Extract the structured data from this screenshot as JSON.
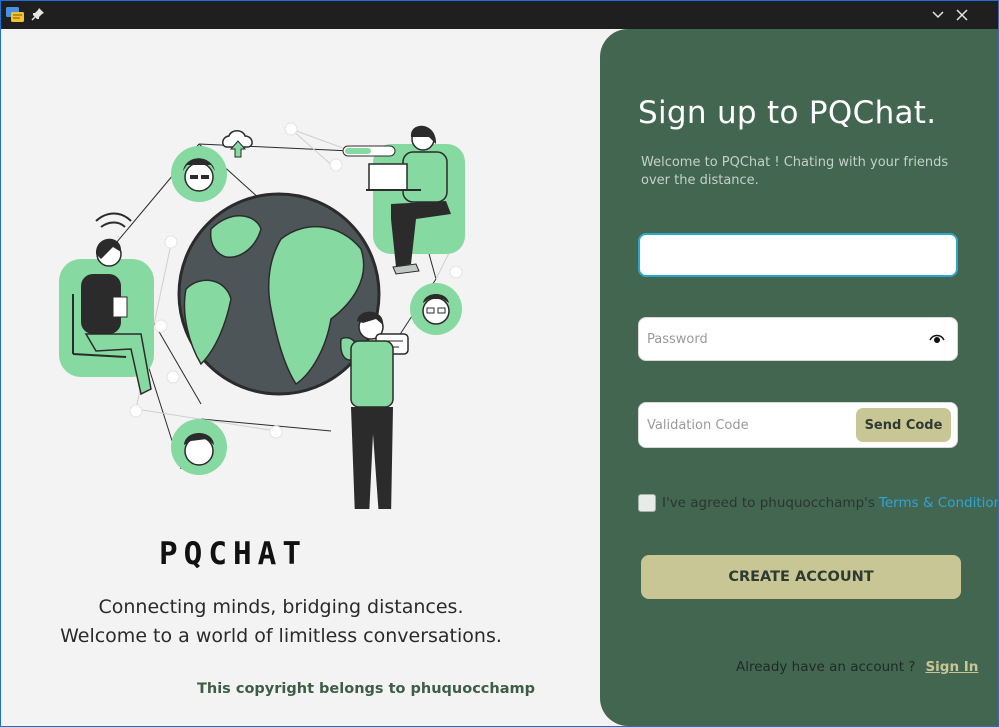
{
  "titlebar": {
    "app_icon": "chat-app-icon",
    "pin_icon": "pin-icon",
    "minimize_icon": "chevron-down-icon",
    "close_icon": "close-icon"
  },
  "left": {
    "illustration": "global-connection-illustration",
    "logo_text": "PQCHAT",
    "tagline_line1": "Connecting minds, bridging distances.",
    "tagline_line2": "Welcome to a world of limitless conversations.",
    "copyright": "This copyright belongs to phuquocchamp"
  },
  "form": {
    "title": "Sign up to PQChat.",
    "subtitle": "Welcome to PQChat ! Chating with your friends over the distance.",
    "email": {
      "value": "",
      "placeholder": ""
    },
    "password": {
      "value": "",
      "placeholder": "Password",
      "icon": "eye-icon"
    },
    "validation_code": {
      "value": "",
      "placeholder": "Validation Code"
    },
    "send_code_label": "Send Code",
    "agree_text": "I've agreed to phuquocchamp's",
    "terms_link": "Terms & Conditions.",
    "create_account_label": "CREATE ACCOUNT",
    "have_account_text": "Already have an account ?",
    "sign_in_link": "Sign In"
  },
  "colors": {
    "panel_green": "#436651",
    "button_khaki": "#c9c695",
    "accent_green": "#86d9a0",
    "link_blue": "#2fa4d8",
    "focus_border": "#2aa7c9"
  }
}
